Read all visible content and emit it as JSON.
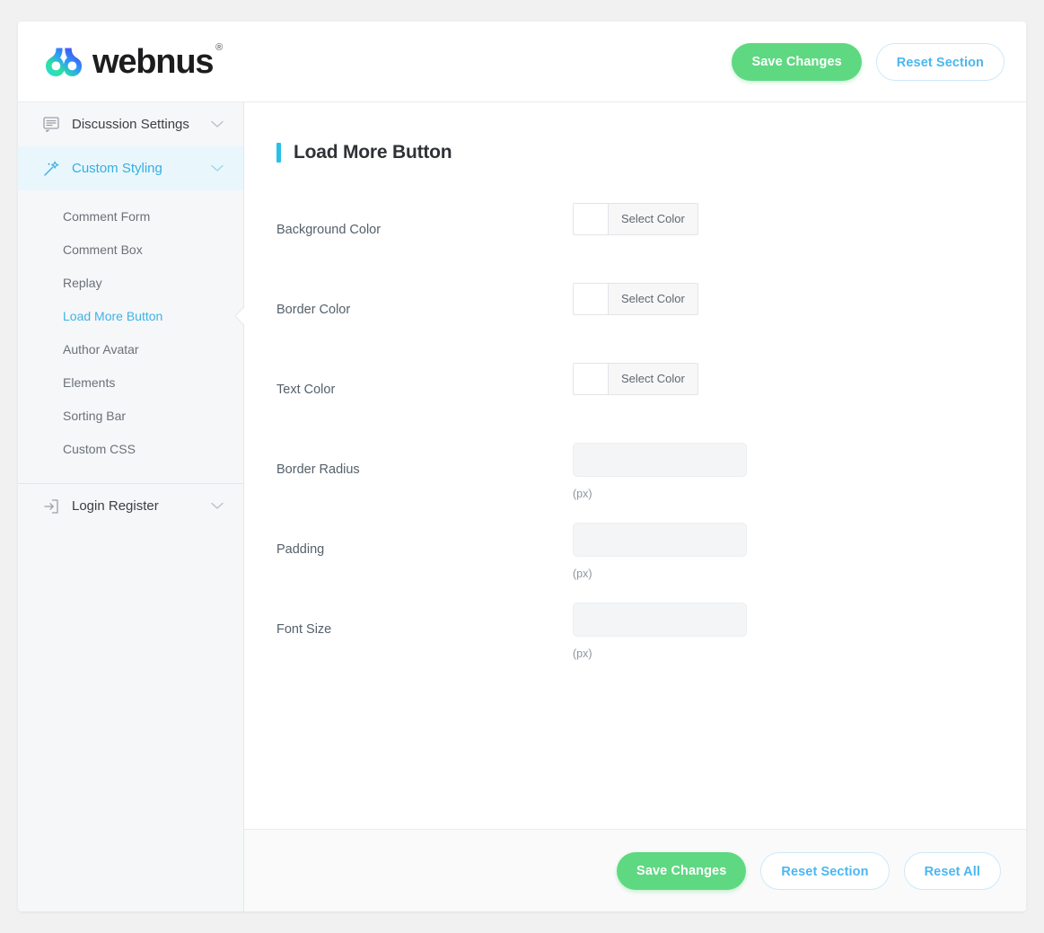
{
  "brand": {
    "name": "webnus",
    "registered_mark": "®",
    "logo_icon": "webnus-gradient-w-logo"
  },
  "header": {
    "save_label": "Save Changes",
    "reset_section_label": "Reset Section"
  },
  "sidebar": {
    "groups": [
      {
        "label": "Discussion Settings",
        "icon": "comment-bubble-icon",
        "chevron": "chevron-down-icon",
        "active": false
      },
      {
        "label": "Custom Styling",
        "icon": "magic-wand-icon",
        "chevron": "chevron-down-icon",
        "active": true
      }
    ],
    "sub_items": [
      {
        "label": "Comment Form",
        "active": false
      },
      {
        "label": "Comment Box",
        "active": false
      },
      {
        "label": "Replay",
        "active": false
      },
      {
        "label": "Load More Button",
        "active": true
      },
      {
        "label": "Author Avatar",
        "active": false
      },
      {
        "label": "Elements",
        "active": false
      },
      {
        "label": "Sorting Bar",
        "active": false
      },
      {
        "label": "Custom CSS",
        "active": false
      }
    ],
    "login_group": {
      "label": "Login Register",
      "icon": "sign-in-icon",
      "chevron": "chevron-down-icon",
      "active": false
    }
  },
  "main": {
    "section_title": "Load More Button",
    "fields": [
      {
        "label": "Background Color",
        "type": "color",
        "button_label": "Select Color",
        "swatch_color": "#ffffff",
        "value": ""
      },
      {
        "label": "Border Color",
        "type": "color",
        "button_label": "Select Color",
        "swatch_color": "#ffffff",
        "value": ""
      },
      {
        "label": "Text Color",
        "type": "color",
        "button_label": "Select Color",
        "swatch_color": "#ffffff",
        "value": ""
      },
      {
        "label": "Border Radius",
        "type": "text",
        "value": "",
        "placeholder": "",
        "hint": "(px)"
      },
      {
        "label": "Padding",
        "type": "text",
        "value": "",
        "placeholder": "",
        "hint": "(px)"
      },
      {
        "label": "Font Size",
        "type": "text",
        "value": "",
        "placeholder": "",
        "hint": "(px)"
      }
    ]
  },
  "footer": {
    "save_label": "Save Changes",
    "reset_section_label": "Reset Section",
    "reset_all_label": "Reset All"
  },
  "colors": {
    "accent_blue": "#36aee0",
    "title_bar": "#29c0e8",
    "save_green": "#5fd882",
    "outline_blue": "#4bb7f0",
    "page_bg": "#f1f1f1",
    "sidebar_bg": "#f6f7f9",
    "active_nav_bg": "#e9f7fd"
  }
}
